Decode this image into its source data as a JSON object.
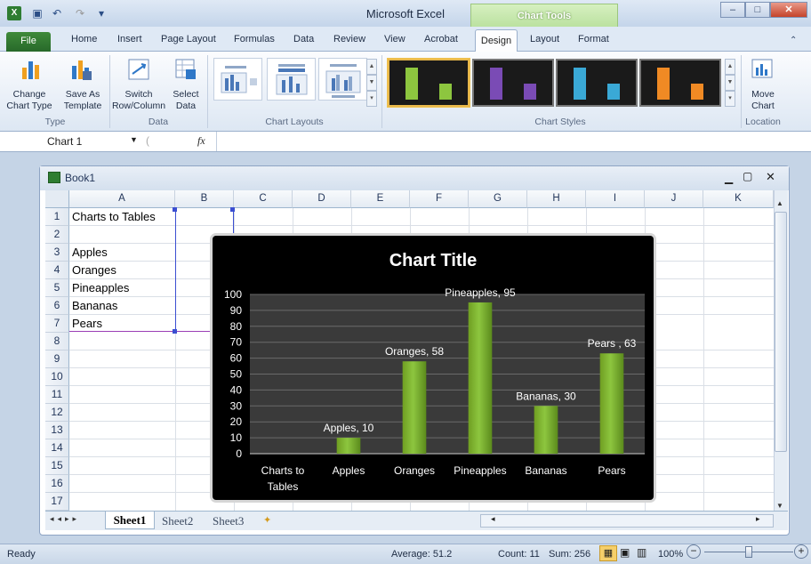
{
  "window": {
    "title": "Microsoft Excel",
    "context_tab": "Chart Tools"
  },
  "ribbon_tabs": [
    "File",
    "Home",
    "Insert",
    "Page Layout",
    "Formulas",
    "Data",
    "Review",
    "View",
    "Acrobat",
    "Design",
    "Layout",
    "Format"
  ],
  "ribbon": {
    "type_group": {
      "label": "Type",
      "change_chart_type": [
        "Change",
        "Chart Type"
      ],
      "save_as_template": [
        "Save As",
        "Template"
      ]
    },
    "data_group": {
      "label": "Data",
      "switch_row_column": [
        "Switch",
        "Row/Column"
      ],
      "select_data": [
        "Select",
        "Data"
      ]
    },
    "layouts_group": {
      "label": "Chart Layouts"
    },
    "styles_group": {
      "label": "Chart Styles",
      "style_colors": [
        "#8dc63f",
        "#7a4bb5",
        "#3aa9d6",
        "#f08a24"
      ]
    },
    "location_group": {
      "label": "Location",
      "move_chart": [
        "Move",
        "Chart"
      ]
    }
  },
  "formula_bar": {
    "name_box": "Chart 1",
    "fx": "fx",
    "formula": ""
  },
  "workbook": {
    "title": "Book1"
  },
  "columns": [
    "A",
    "B",
    "C",
    "D",
    "E",
    "F",
    "G",
    "H",
    "I",
    "J",
    "K"
  ],
  "rows": [
    "1",
    "2",
    "3",
    "4",
    "5",
    "6",
    "7",
    "8",
    "9",
    "10",
    "11",
    "12",
    "13",
    "14",
    "15",
    "16",
    "17"
  ],
  "cells": {
    "A1": "Charts to Tables",
    "A3": "Apples",
    "A4": "Oranges",
    "A5": "Pineapples",
    "A6": "Bananas",
    "A7": "Pears"
  },
  "sheets": {
    "active": "Sheet1",
    "others": [
      "Sheet2",
      "Sheet3"
    ]
  },
  "status_bar": {
    "ready": "Ready",
    "average": "Average: 51.2",
    "count": "Count: 11",
    "sum": "Sum: 256",
    "zoom": "100%"
  },
  "chart_data": {
    "type": "bar",
    "title": "Chart Title",
    "categories": [
      "Charts to Tables",
      "Apples",
      "Oranges",
      "Pineapples",
      "Bananas",
      "Pears"
    ],
    "values": [
      null,
      10,
      58,
      95,
      30,
      63
    ],
    "data_labels": [
      "",
      "Apples, 10",
      "Oranges, 58",
      "Pineapples, 95",
      "Bananas, 30",
      "Pears , 63"
    ],
    "ylim": [
      0,
      100
    ],
    "yticks": [
      0,
      10,
      20,
      30,
      40,
      50,
      60,
      70,
      80,
      90,
      100
    ],
    "grid": true,
    "bar_color": "#8dc63f",
    "background": "#000000",
    "plot_background": "#3a3a3a"
  }
}
